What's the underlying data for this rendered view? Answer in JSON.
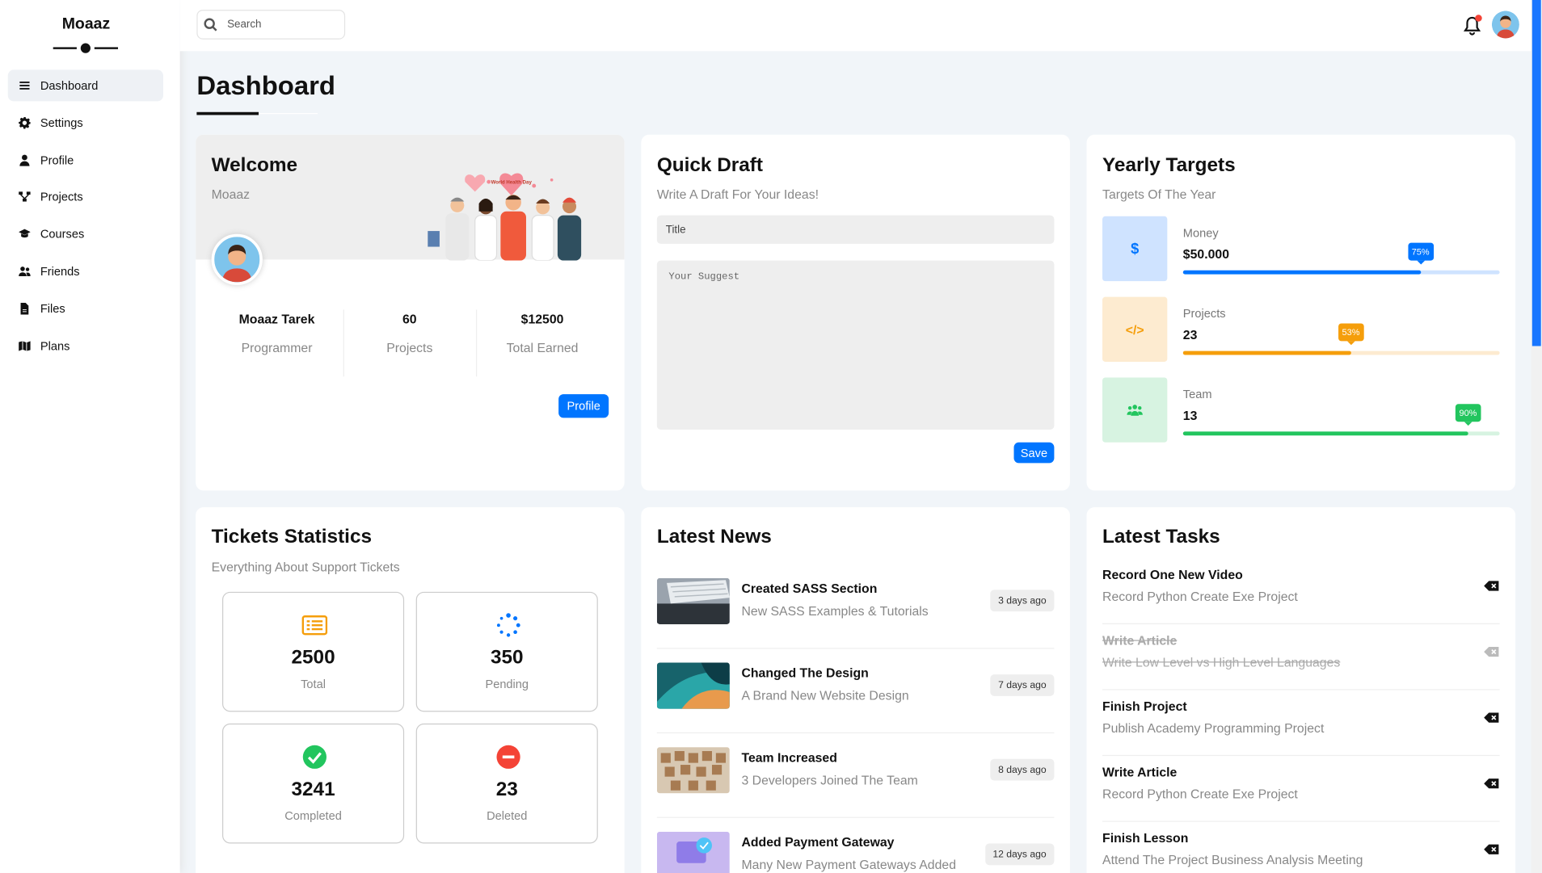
{
  "brand": {
    "name": "Moaaz"
  },
  "sidebar": {
    "items": [
      {
        "label": "Dashboard",
        "icon": "dashboard-icon"
      },
      {
        "label": "Settings",
        "icon": "gear-icon"
      },
      {
        "label": "Profile",
        "icon": "user-icon"
      },
      {
        "label": "Projects",
        "icon": "diagram-icon"
      },
      {
        "label": "Courses",
        "icon": "graduation-cap-icon"
      },
      {
        "label": "Friends",
        "icon": "users-icon"
      },
      {
        "label": "Files",
        "icon": "file-icon"
      },
      {
        "label": "Plans",
        "icon": "map-icon"
      }
    ]
  },
  "header": {
    "search_placeholder": "Search"
  },
  "page": {
    "title": "Dashboard"
  },
  "welcome": {
    "title": "Welcome",
    "subtitle": "Moaaz",
    "illustration_text": "World Health Day",
    "stats": [
      {
        "value": "Moaaz Tarek",
        "label": "Programmer"
      },
      {
        "value": "60",
        "label": "Projects"
      },
      {
        "value": "$12500",
        "label": "Total Earned"
      }
    ],
    "button": "Profile"
  },
  "draft": {
    "title": "Quick Draft",
    "subtitle": "Write A Draft For Your Ideas!",
    "title_placeholder": "Title",
    "body_placeholder": "Your Suggest",
    "button": "Save"
  },
  "targets": {
    "title": "Yearly Targets",
    "subtitle": "Targets Of The Year",
    "items": [
      {
        "label": "Money",
        "value": "$50.000",
        "percent": "75%",
        "progress": 0.75,
        "icon": "dollar-icon",
        "color": "#0075ff",
        "bg": "#cfe3ff",
        "track": "#cfe3ff"
      },
      {
        "label": "Projects",
        "value": "23",
        "percent": "53%",
        "progress": 0.53,
        "icon": "code-icon",
        "color": "#f59e0b",
        "bg": "#fdebd0",
        "track": "#fdebd0"
      },
      {
        "label": "Team",
        "value": "13",
        "percent": "90%",
        "progress": 0.9,
        "icon": "users-icon",
        "color": "#22c55e",
        "bg": "#d7f3e1",
        "track": "#d7f3e1"
      }
    ]
  },
  "tickets": {
    "title": "Tickets Statistics",
    "subtitle": "Everything About Support Tickets",
    "items": [
      {
        "value": "2500",
        "label": "Total",
        "icon": "list-icon",
        "color": "#f59e0b"
      },
      {
        "value": "350",
        "label": "Pending",
        "icon": "spinner-icon",
        "color": "#0075ff"
      },
      {
        "value": "3241",
        "label": "Completed",
        "icon": "check-circle-icon",
        "color": "#22c55e"
      },
      {
        "value": "23",
        "label": "Deleted",
        "icon": "minus-circle-icon",
        "color": "#f44336"
      }
    ]
  },
  "news": {
    "title": "Latest News",
    "items": [
      {
        "title": "Created SASS Section",
        "desc": "New SASS Examples & Tutorials",
        "ago": "3 days ago"
      },
      {
        "title": "Changed The Design",
        "desc": "A Brand New Website Design",
        "ago": "7 days ago"
      },
      {
        "title": "Team Increased",
        "desc": "3 Developers Joined The Team",
        "ago": "8 days ago"
      },
      {
        "title": "Added Payment Gateway",
        "desc": "Many New Payment Gateways Added",
        "ago": "12 days ago"
      }
    ]
  },
  "tasks": {
    "title": "Latest Tasks",
    "items": [
      {
        "title": "Record One New Video",
        "desc": "Record Python Create Exe Project",
        "done": false
      },
      {
        "title": "Write Article",
        "desc": "Write Low Level vs High Level Languages",
        "done": true
      },
      {
        "title": "Finish Project",
        "desc": "Publish Academy Programming Project",
        "done": false
      },
      {
        "title": "Write Article",
        "desc": "Record Python Create Exe Project",
        "done": false
      },
      {
        "title": "Finish Lesson",
        "desc": "Attend The Project Business Analysis Meeting",
        "done": false
      }
    ]
  }
}
